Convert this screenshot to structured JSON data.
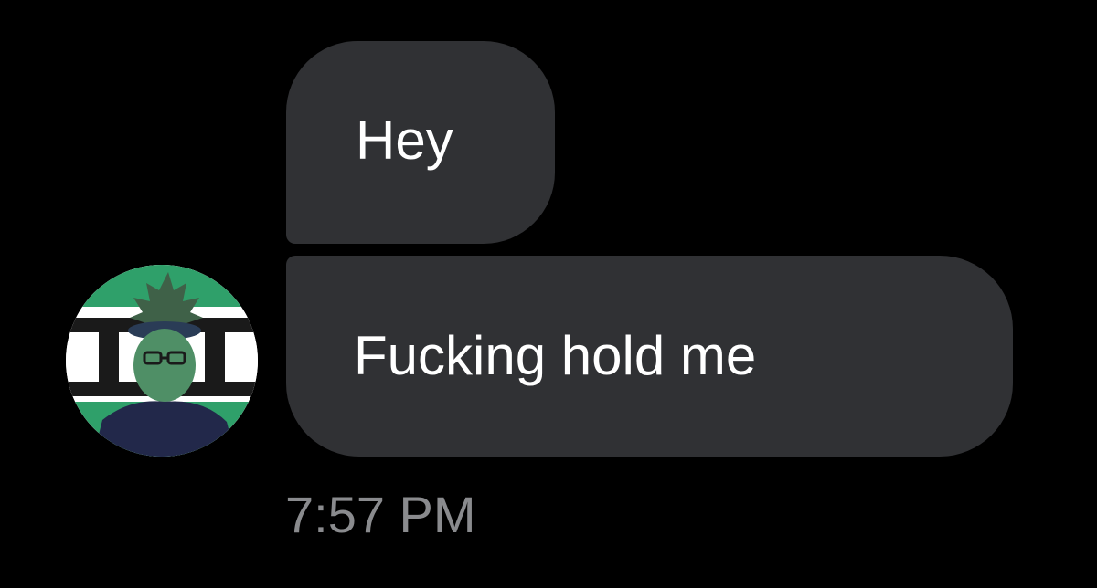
{
  "conversation": {
    "messages": [
      {
        "text": "Hey"
      },
      {
        "text": "Fucking hold me"
      }
    ],
    "timestamp": "7:57 PM",
    "sender_avatar": {
      "icon": "profile-avatar"
    }
  },
  "colors": {
    "background": "#000000",
    "bubble": "#303134",
    "message_text": "#ffffff",
    "timestamp_text": "#8a8b8e",
    "avatar_green": "#2fa06a"
  }
}
